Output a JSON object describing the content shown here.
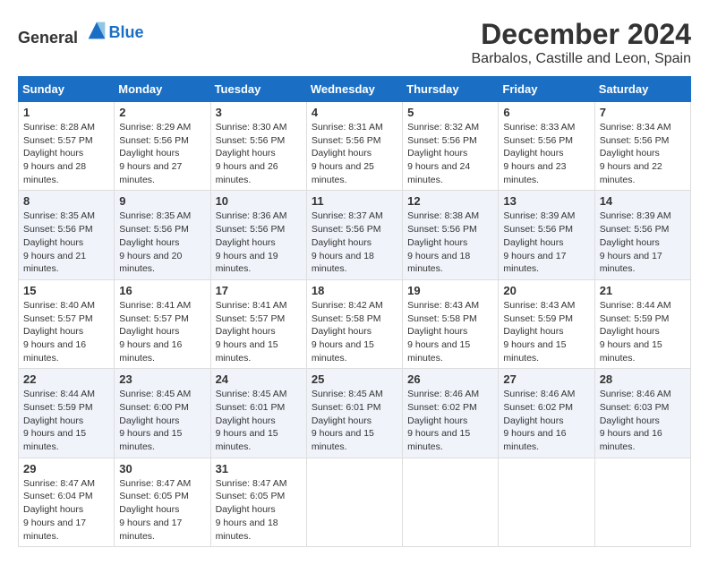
{
  "header": {
    "logo_general": "General",
    "logo_blue": "Blue",
    "month": "December 2024",
    "location": "Barbalos, Castille and Leon, Spain"
  },
  "days_of_week": [
    "Sunday",
    "Monday",
    "Tuesday",
    "Wednesday",
    "Thursday",
    "Friday",
    "Saturday"
  ],
  "weeks": [
    [
      {
        "day": 1,
        "sunrise": "8:28 AM",
        "sunset": "5:57 PM",
        "daylight": "9 hours and 28 minutes."
      },
      {
        "day": 2,
        "sunrise": "8:29 AM",
        "sunset": "5:56 PM",
        "daylight": "9 hours and 27 minutes."
      },
      {
        "day": 3,
        "sunrise": "8:30 AM",
        "sunset": "5:56 PM",
        "daylight": "9 hours and 26 minutes."
      },
      {
        "day": 4,
        "sunrise": "8:31 AM",
        "sunset": "5:56 PM",
        "daylight": "9 hours and 25 minutes."
      },
      {
        "day": 5,
        "sunrise": "8:32 AM",
        "sunset": "5:56 PM",
        "daylight": "9 hours and 24 minutes."
      },
      {
        "day": 6,
        "sunrise": "8:33 AM",
        "sunset": "5:56 PM",
        "daylight": "9 hours and 23 minutes."
      },
      {
        "day": 7,
        "sunrise": "8:34 AM",
        "sunset": "5:56 PM",
        "daylight": "9 hours and 22 minutes."
      }
    ],
    [
      {
        "day": 8,
        "sunrise": "8:35 AM",
        "sunset": "5:56 PM",
        "daylight": "9 hours and 21 minutes."
      },
      {
        "day": 9,
        "sunrise": "8:35 AM",
        "sunset": "5:56 PM",
        "daylight": "9 hours and 20 minutes."
      },
      {
        "day": 10,
        "sunrise": "8:36 AM",
        "sunset": "5:56 PM",
        "daylight": "9 hours and 19 minutes."
      },
      {
        "day": 11,
        "sunrise": "8:37 AM",
        "sunset": "5:56 PM",
        "daylight": "9 hours and 18 minutes."
      },
      {
        "day": 12,
        "sunrise": "8:38 AM",
        "sunset": "5:56 PM",
        "daylight": "9 hours and 18 minutes."
      },
      {
        "day": 13,
        "sunrise": "8:39 AM",
        "sunset": "5:56 PM",
        "daylight": "9 hours and 17 minutes."
      },
      {
        "day": 14,
        "sunrise": "8:39 AM",
        "sunset": "5:56 PM",
        "daylight": "9 hours and 17 minutes."
      }
    ],
    [
      {
        "day": 15,
        "sunrise": "8:40 AM",
        "sunset": "5:57 PM",
        "daylight": "9 hours and 16 minutes."
      },
      {
        "day": 16,
        "sunrise": "8:41 AM",
        "sunset": "5:57 PM",
        "daylight": "9 hours and 16 minutes."
      },
      {
        "day": 17,
        "sunrise": "8:41 AM",
        "sunset": "5:57 PM",
        "daylight": "9 hours and 15 minutes."
      },
      {
        "day": 18,
        "sunrise": "8:42 AM",
        "sunset": "5:58 PM",
        "daylight": "9 hours and 15 minutes."
      },
      {
        "day": 19,
        "sunrise": "8:43 AM",
        "sunset": "5:58 PM",
        "daylight": "9 hours and 15 minutes."
      },
      {
        "day": 20,
        "sunrise": "8:43 AM",
        "sunset": "5:59 PM",
        "daylight": "9 hours and 15 minutes."
      },
      {
        "day": 21,
        "sunrise": "8:44 AM",
        "sunset": "5:59 PM",
        "daylight": "9 hours and 15 minutes."
      }
    ],
    [
      {
        "day": 22,
        "sunrise": "8:44 AM",
        "sunset": "5:59 PM",
        "daylight": "9 hours and 15 minutes."
      },
      {
        "day": 23,
        "sunrise": "8:45 AM",
        "sunset": "6:00 PM",
        "daylight": "9 hours and 15 minutes."
      },
      {
        "day": 24,
        "sunrise": "8:45 AM",
        "sunset": "6:01 PM",
        "daylight": "9 hours and 15 minutes."
      },
      {
        "day": 25,
        "sunrise": "8:45 AM",
        "sunset": "6:01 PM",
        "daylight": "9 hours and 15 minutes."
      },
      {
        "day": 26,
        "sunrise": "8:46 AM",
        "sunset": "6:02 PM",
        "daylight": "9 hours and 15 minutes."
      },
      {
        "day": 27,
        "sunrise": "8:46 AM",
        "sunset": "6:02 PM",
        "daylight": "9 hours and 16 minutes."
      },
      {
        "day": 28,
        "sunrise": "8:46 AM",
        "sunset": "6:03 PM",
        "daylight": "9 hours and 16 minutes."
      }
    ],
    [
      {
        "day": 29,
        "sunrise": "8:47 AM",
        "sunset": "6:04 PM",
        "daylight": "9 hours and 17 minutes."
      },
      {
        "day": 30,
        "sunrise": "8:47 AM",
        "sunset": "6:05 PM",
        "daylight": "9 hours and 17 minutes."
      },
      {
        "day": 31,
        "sunrise": "8:47 AM",
        "sunset": "6:05 PM",
        "daylight": "9 hours and 18 minutes."
      },
      null,
      null,
      null,
      null
    ]
  ]
}
